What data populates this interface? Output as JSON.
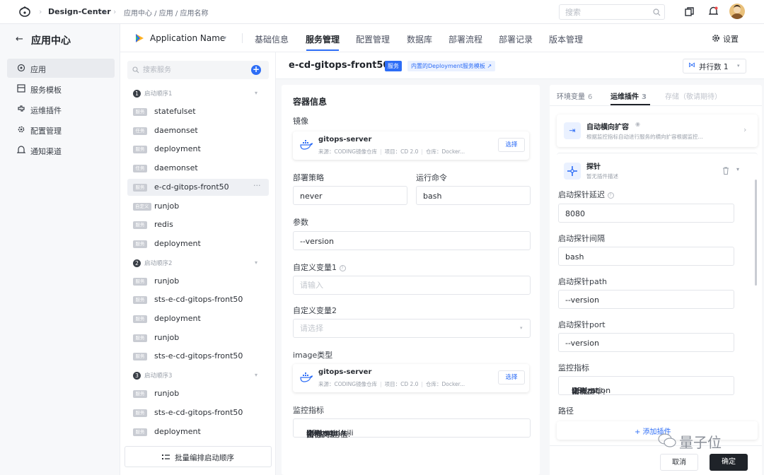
{
  "topbar": {
    "project": "Design-Center",
    "breadcrumb": "应用中心 / 应用 / 应用名称",
    "search_placeholder": "搜索"
  },
  "leftnav": {
    "title": "应用中心",
    "items": [
      {
        "label": "应用",
        "icon": "app-icon"
      },
      {
        "label": "服务模板",
        "icon": "template-icon"
      },
      {
        "label": "运维插件",
        "icon": "plugin-icon"
      },
      {
        "label": "配置管理",
        "icon": "gear-icon"
      },
      {
        "label": "通知渠道",
        "icon": "bell-icon"
      }
    ]
  },
  "app": {
    "name": "Application Name",
    "tabs": [
      "基础信息",
      "服务管理",
      "配置管理",
      "数据库",
      "部署流程",
      "部署记录",
      "版本管理"
    ],
    "active_tab": "服务管理",
    "settings_label": "设置"
  },
  "services": {
    "search_placeholder": "搜索服务",
    "groups": [
      {
        "num": "1",
        "label": "启动顺序1",
        "rows": [
          {
            "tag": "服务",
            "name": "statefulset"
          },
          {
            "tag": "任务",
            "name": "daemonset"
          },
          {
            "tag": "服务",
            "name": "deployment"
          },
          {
            "tag": "任务",
            "name": "daemonset"
          },
          {
            "tag": "服务",
            "name": "e-cd-gitops-front50",
            "active": true
          },
          {
            "tag": "自定义",
            "name": "runjob"
          },
          {
            "tag": "服务",
            "name": "redis"
          },
          {
            "tag": "服务",
            "name": "deployment"
          }
        ]
      },
      {
        "num": "2",
        "label": "启动顺序2",
        "rows": [
          {
            "tag": "服务",
            "name": "runjob"
          },
          {
            "tag": "服务",
            "name": "sts-e-cd-gitops-front50"
          },
          {
            "tag": "服务",
            "name": "deployment"
          },
          {
            "tag": "服务",
            "name": "runjob"
          },
          {
            "tag": "服务",
            "name": "sts-e-cd-gitops-front50"
          }
        ]
      },
      {
        "num": "3",
        "label": "启动顺序3",
        "rows": [
          {
            "tag": "服务",
            "name": "runjob"
          },
          {
            "tag": "服务",
            "name": "sts-e-cd-gitops-front50"
          },
          {
            "tag": "服务",
            "name": "deployment"
          }
        ]
      }
    ],
    "batch_label": "批量编排启动顺序"
  },
  "detail": {
    "title": "e-cd-gitops-front50",
    "type_tag": "服务",
    "template_tag": "内置的Deployment服务模板",
    "parallel_label": "并行数 1",
    "container": {
      "section": "容器信息",
      "image_label": "镜像",
      "image_name": "gitops-server",
      "image_source": "来源：CODING镜像仓库",
      "image_project": "项目：CD 2.0",
      "image_repo": "仓库：Docker...",
      "select_label": "选择",
      "strategy_label": "部署策略",
      "strategy_value": "never",
      "command_label": "运行命令",
      "command_value": "bash",
      "args_label": "参数",
      "args_value": "--version",
      "var1_label": "自定义变量1",
      "var1_placeholder": "请输入",
      "var2_label": "自定义变量2",
      "var2_placeholder": "请选择",
      "image_type_label": "image类型",
      "metric_label": "监控指标",
      "metric_name_key": "名称:",
      "metric_name": "CPU",
      "metric_type_key": "指标类型:",
      "metric_type": "Utilization",
      "metric_threshold_key": "阈值/平均值:",
      "metric_threshold": "averageUtili"
    },
    "right": {
      "tabs": [
        {
          "label": "环境变量",
          "count": "6"
        },
        {
          "label": "运维插件",
          "count": "3"
        },
        {
          "label": "存储（敬请期待）",
          "count": ""
        }
      ],
      "plugin1_title": "自动横向扩容",
      "plugin1_desc": "根据监控指标自动进行服务的横向扩容根据监控...",
      "plugin2_title": "探针",
      "plugin2_desc": "暂无插件描述",
      "fields": [
        {
          "label": "启动探针延迟",
          "value": "8080"
        },
        {
          "label": "启动探针间隔",
          "value": "bash"
        },
        {
          "label": "启动探针path",
          "value": "--version"
        },
        {
          "label": "启动探针port",
          "value": "--version"
        }
      ],
      "metric_label": "监控指标",
      "metric_name_key": "名称:",
      "metric_name": "CPU",
      "metric_type_key": "指标类型:",
      "metric_type": "Utilization",
      "metric_threshold_key": "阈值/平",
      "path_label": "路径",
      "add_label": "+ 添加插件",
      "cancel_label": "取消",
      "confirm_label": "确定"
    }
  },
  "watermark": "量子位",
  "colors": {
    "accent": "#2d6df6",
    "dark": "#1f2329"
  }
}
